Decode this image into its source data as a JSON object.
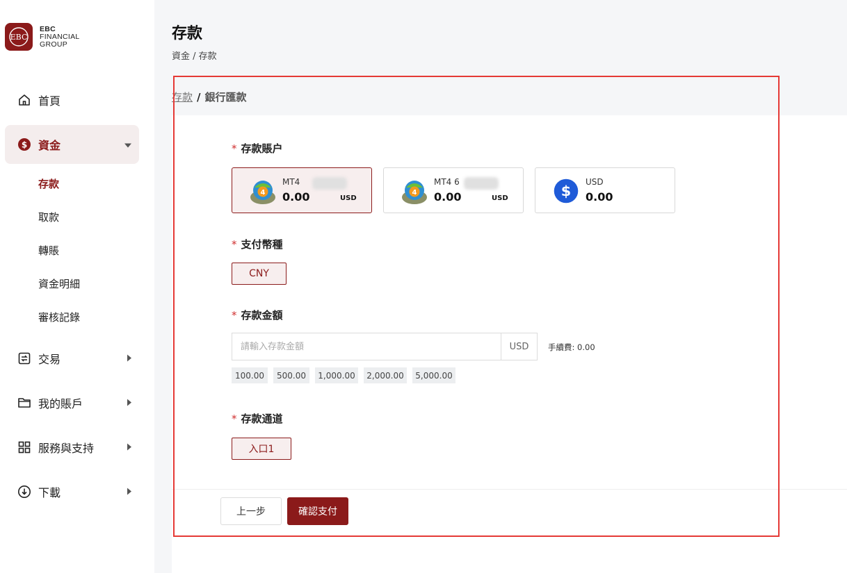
{
  "brand": {
    "line1": "EBC",
    "line2": "FINANCIAL",
    "line3": "GROUP",
    "color": "#8b1a1a"
  },
  "sidebar": {
    "home": "首頁",
    "funds": "資金",
    "funds_sub": [
      "存款",
      "取款",
      "轉賬",
      "資金明細",
      "審核記錄"
    ],
    "trade": "交易",
    "my_account": "我的賬戶",
    "services": "服務與支持",
    "download": "下載"
  },
  "header": {
    "title": "存款",
    "breadcrumb": "資金 / 存款"
  },
  "subcrumb": {
    "link": "存款",
    "sep": "/",
    "current": "銀行匯款"
  },
  "form": {
    "account_label": "存款賬户",
    "accounts": [
      {
        "name": "MT4",
        "balance": "0.00",
        "currency": "USD",
        "icon": "mt4-icon",
        "selected": true
      },
      {
        "name": "MT4 6",
        "balance": "0.00",
        "currency": "USD",
        "icon": "mt4-icon",
        "selected": false
      },
      {
        "name": "USD",
        "balance": "0.00",
        "currency": "",
        "icon": "dollar-icon",
        "selected": false
      }
    ],
    "currency_label": "支付幣種",
    "currency_value": "CNY",
    "amount_label": "存款金額",
    "amount_placeholder": "請輸入存款金額",
    "amount_unit": "USD",
    "fee": "手續費: 0.00",
    "quick_amounts": [
      "100.00",
      "500.00",
      "1,000.00",
      "2,000.00",
      "5,000.00"
    ],
    "channel_label": "存款通道",
    "channel_value": "入口1",
    "required_mark": "*"
  },
  "buttons": {
    "prev": "上一步",
    "confirm": "確認支付"
  }
}
